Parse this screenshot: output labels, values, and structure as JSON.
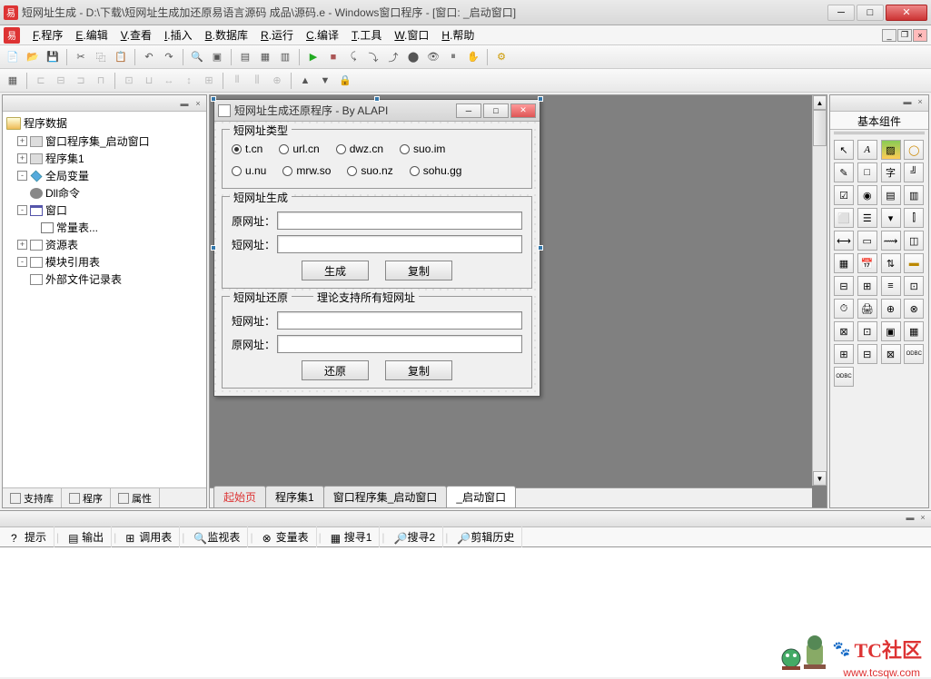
{
  "titlebar": {
    "text": "短网址生成 - D:\\下载\\短网址生成加还原易语言源码 成品\\源码.e - Windows窗口程序 - [窗口: _启动窗口]"
  },
  "menu": {
    "items": [
      {
        "key": "F",
        "label": "程序"
      },
      {
        "key": "E",
        "label": "编辑"
      },
      {
        "key": "V",
        "label": "查看"
      },
      {
        "key": "I",
        "label": "插入"
      },
      {
        "key": "B",
        "label": "数据库"
      },
      {
        "key": "R",
        "label": "运行"
      },
      {
        "key": "C",
        "label": "编译"
      },
      {
        "key": "T",
        "label": "工具"
      },
      {
        "key": "W",
        "label": "窗口"
      },
      {
        "key": "H",
        "label": "帮助"
      }
    ]
  },
  "tree": {
    "root": "程序数据",
    "nodes": [
      {
        "label": "窗口程序集_启动窗口",
        "icon": "stack",
        "exp": "+"
      },
      {
        "label": "程序集1",
        "icon": "stack",
        "exp": "+"
      },
      {
        "label": "全局变量",
        "icon": "diamond",
        "exp": "-"
      },
      {
        "label": "Dll命令",
        "icon": "gear",
        "exp": ""
      },
      {
        "label": "窗口",
        "icon": "window",
        "exp": "-",
        "children": [
          {
            "label": "常量表...",
            "icon": "table"
          }
        ]
      },
      {
        "label": "资源表",
        "icon": "doc",
        "exp": "+"
      },
      {
        "label": "模块引用表",
        "icon": "doc",
        "exp": "-"
      },
      {
        "label": "外部文件记录表",
        "icon": "doc",
        "exp": ""
      }
    ]
  },
  "left_tabs": [
    "支持库",
    "程序",
    "属性"
  ],
  "form": {
    "title": "短网址生成还原程序 - By ALAPI",
    "group1": {
      "title": "短网址类型",
      "row1": [
        "t.cn",
        "url.cn",
        "dwz.cn",
        "suo.im"
      ],
      "row2": [
        "u.nu",
        "mrw.so",
        "suo.nz",
        "sohu.gg"
      ],
      "selected": "t.cn"
    },
    "group2": {
      "title": "短网址生成",
      "label1": "原网址：",
      "label2": "短网址：",
      "btn1": "生成",
      "btn2": "复制"
    },
    "group3": {
      "title": "短网址还原",
      "subtitle": "理论支持所有短网址",
      "label1": "短网址：",
      "label2": "原网址：",
      "btn1": "还原",
      "btn2": "复制"
    }
  },
  "right": {
    "title": "基本组件"
  },
  "center_tabs": {
    "start": "起始页",
    "items": [
      "程序集1",
      "窗口程序集_启动窗口"
    ],
    "active": "_启动窗口"
  },
  "bottom_tabs": [
    "提示",
    "输出",
    "调用表",
    "监视表",
    "变量表",
    "搜寻1",
    "搜寻2",
    "剪辑历史"
  ],
  "watermark": {
    "text": "TC社区",
    "url": "www.tcsqw.com"
  }
}
